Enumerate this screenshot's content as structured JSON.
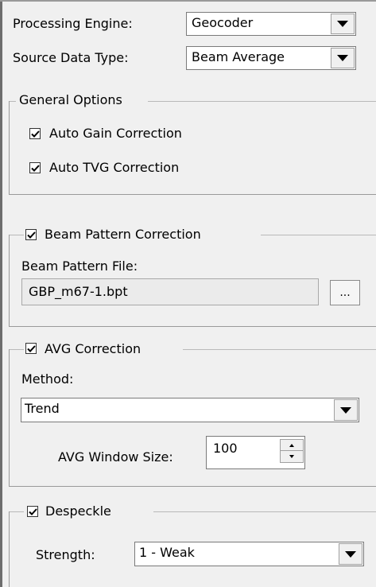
{
  "processing_engine": {
    "label": "Processing Engine:",
    "value": "Geocoder"
  },
  "source_data_type": {
    "label": "Source Data Type:",
    "value": "Beam Average"
  },
  "general_options": {
    "title": "General Options",
    "auto_gain": {
      "label": "Auto Gain Correction",
      "checked": true
    },
    "auto_tvg": {
      "label": "Auto TVG Correction",
      "checked": true
    }
  },
  "beam_pattern": {
    "label": "Beam Pattern Correction",
    "checked": true,
    "file_label": "Beam Pattern File:",
    "file_value": "GBP_m67-1.bpt",
    "browse_label": "..."
  },
  "avg": {
    "label": "AVG Correction",
    "checked": true,
    "method_label": "Method:",
    "method_value": "Trend",
    "window_label": "AVG Window Size:",
    "window_value": "100"
  },
  "despeckle": {
    "label": "Despeckle",
    "checked": true,
    "strength_label": "Strength:",
    "strength_value": "1 - Weak"
  }
}
